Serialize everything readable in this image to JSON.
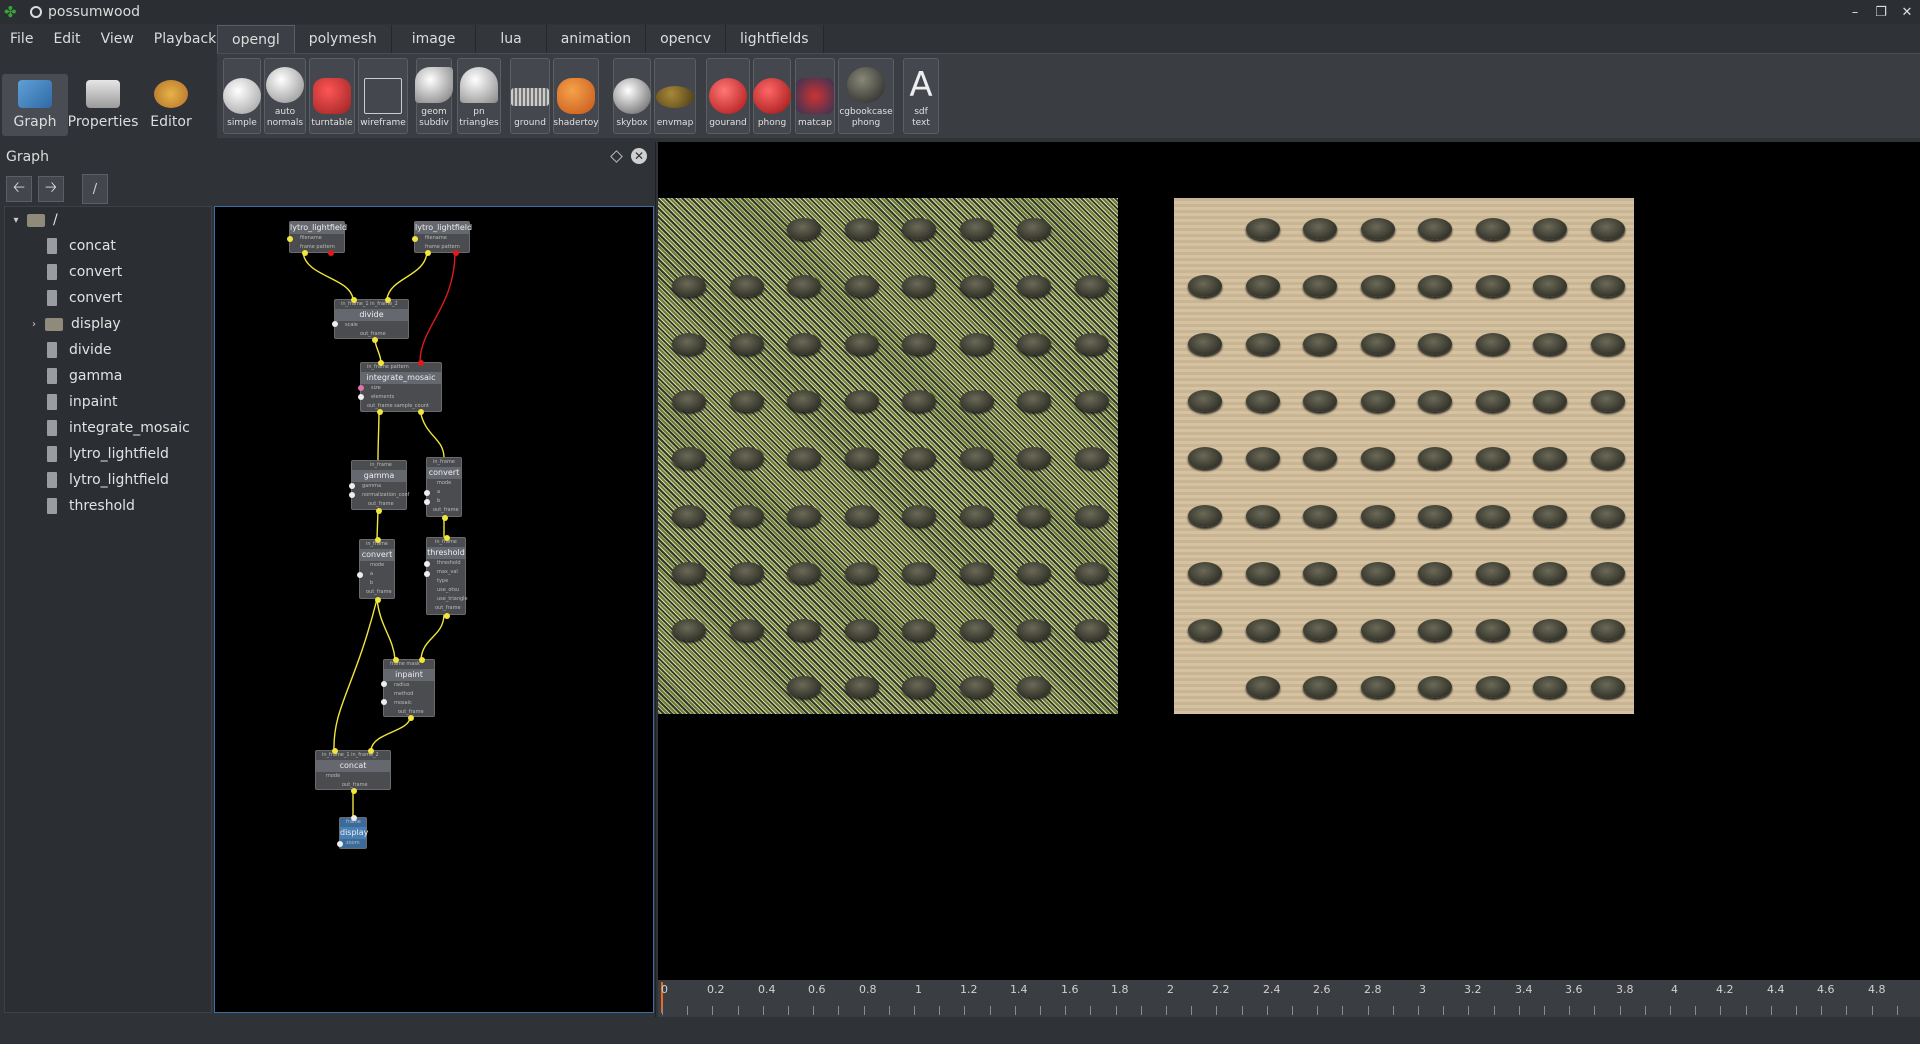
{
  "window": {
    "title": "possumwood",
    "controls": [
      "–",
      "❐",
      "✕"
    ]
  },
  "menu": [
    "File",
    "Edit",
    "View",
    "Playback"
  ],
  "modes": [
    {
      "label": "Graph",
      "icon": "graph-icon",
      "active": true
    },
    {
      "label": "Properties",
      "icon": "properties-icon",
      "active": false
    },
    {
      "label": "Editor",
      "icon": "editor-icon",
      "active": false
    }
  ],
  "shelf_tabs": [
    "opengl",
    "polymesh",
    "image",
    "lua",
    "animation",
    "opencv",
    "lightfields"
  ],
  "active_shelf_tab": "opengl",
  "tools": [
    {
      "label": "simple",
      "icon": "teapot-icon"
    },
    {
      "label": "auto\nnormals",
      "icon": "teapot-icon"
    },
    {
      "label": "turntable",
      "icon": "car-icon"
    },
    {
      "label": "wireframe",
      "icon": "wireframe-cube-icon"
    },
    {
      "label": "geom\nsubdiv",
      "icon": "shape-icon"
    },
    {
      "label": "pn\ntriangles",
      "icon": "cone-icon"
    },
    {
      "label": "ground",
      "icon": "ground-plane-icon"
    },
    {
      "label": "shadertoy",
      "icon": "shadertoy-icon"
    },
    {
      "label": "skybox",
      "icon": "sphere-icon"
    },
    {
      "label": "envmap",
      "icon": "envmap-icon"
    },
    {
      "label": "gourand",
      "icon": "red-teapot-icon"
    },
    {
      "label": "phong",
      "icon": "red-teapot-icon"
    },
    {
      "label": "matcap",
      "icon": "figure-icon"
    },
    {
      "label": "cgbookcase\nphong",
      "icon": "rock-sphere-icon"
    },
    {
      "label": "sdf\ntext",
      "icon": "letter-a-icon"
    }
  ],
  "graph_panel": {
    "title": "Graph",
    "back": "🡠",
    "forward": "🡢",
    "path": "/",
    "tree_root": "/",
    "tree_items": [
      "concat",
      "convert",
      "convert",
      "display",
      "divide",
      "gamma",
      "inpaint",
      "integrate_mosaic",
      "lytro_lightfield",
      "lytro_lightfield",
      "threshold"
    ]
  },
  "nodes": [
    {
      "title": "lytro_lightfield",
      "ports": [
        "filename",
        "frame      pattern"
      ]
    },
    {
      "title": "lytro_lightfield",
      "ports": [
        "filename",
        "frame      pattern"
      ]
    },
    {
      "title": "divide",
      "header": "in_frame_1    in_frame_2",
      "ports": [
        "scale",
        "out_frame"
      ]
    },
    {
      "title": "integrate_mosaic",
      "header": "in_frame          pattern",
      "ports": [
        "size",
        "elements",
        "out_frame    sample_count"
      ]
    },
    {
      "title": "gamma",
      "header": "in_frame",
      "ports": [
        "gamma",
        "normalization_coef",
        "out_frame"
      ]
    },
    {
      "title": "convert",
      "header": "in_frame",
      "ports": [
        "mode",
        "a",
        "b",
        "out_frame"
      ]
    },
    {
      "title": "convert",
      "header": "in_frame",
      "ports": [
        "mode",
        "a",
        "b",
        "out_frame"
      ]
    },
    {
      "title": "threshold",
      "header": "in_frame",
      "ports": [
        "threshold",
        "max_val",
        "type",
        "use_otsu",
        "use_triangle",
        "out_frame"
      ]
    },
    {
      "title": "inpaint",
      "header": "frame     mask",
      "ports": [
        "radius",
        "method",
        "mosaic",
        "out_frame"
      ]
    },
    {
      "title": "concat",
      "header": "in_frame_1    in_frame_2",
      "ports": [
        "mode",
        "out_frame"
      ]
    },
    {
      "title": "display",
      "header": "frame",
      "ports": [
        "zoom"
      ]
    }
  ],
  "timeline": {
    "labels": [
      "0",
      "0.2",
      "0.4",
      "0.6",
      "0.8",
      "1",
      "1.2",
      "1.4",
      "1.6",
      "1.8",
      "2",
      "2.2",
      "2.4",
      "2.6",
      "2.8",
      "3",
      "3.2",
      "3.4",
      "3.6",
      "3.8",
      "4",
      "4.2",
      "4.4",
      "4.6",
      "4.8"
    ],
    "playhead_value": 0
  },
  "colors": {
    "accent": "#3a6ea5",
    "playhead": "#e86a1a",
    "port_yellow": "#f2e63c",
    "port_red": "#e01a1a"
  }
}
